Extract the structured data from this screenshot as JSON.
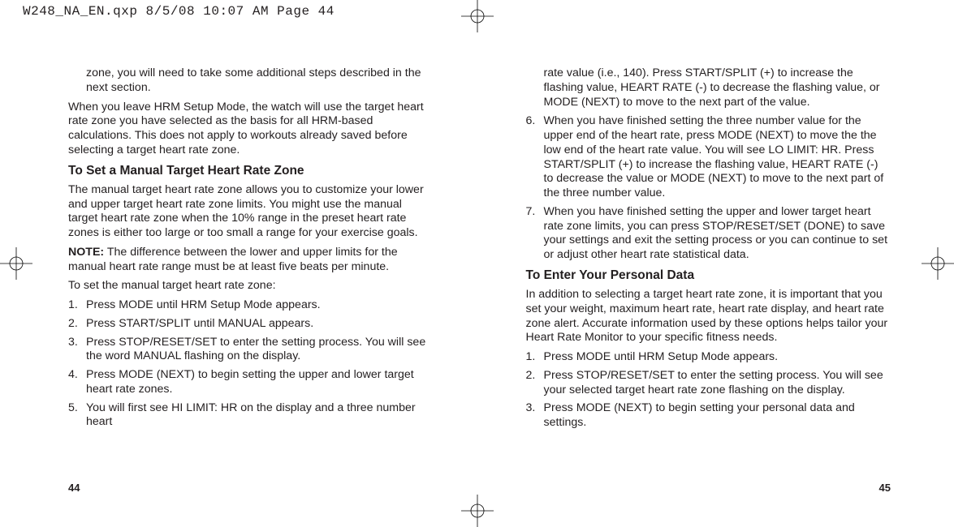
{
  "slug": "W248_NA_EN.qxp  8/5/08  10:07 AM  Page 44",
  "left_page": {
    "cont1": "zone, you will need to take some additional steps described in the next section.",
    "para1": "When you leave HRM Setup Mode, the watch will use the target heart rate zone you have selected as the basis for all HRM-based calculations. This does not apply to workouts already saved before selecting a target heart rate zone.",
    "h1": "To Set a Manual Target Heart Rate Zone",
    "para2": "The manual target heart rate zone allows you to customize your lower and upper target heart rate zone limits. You might use the manual target heart rate zone when the 10% range in the preset heart rate zones is either too large or too small a range for your exercise goals.",
    "note_label": "NOTE:",
    "note_text": " The difference between the lower and upper limits for the manual heart rate range must be at least five beats per minute.",
    "para3": "To set the manual target heart rate zone:",
    "steps": [
      "Press MODE until HRM Setup Mode appears.",
      "Press START/SPLIT until MANUAL appears.",
      "Press STOP/RESET/SET to enter the setting process. You will see the word MANUAL flashing on the display.",
      "Press MODE (NEXT) to begin setting the upper and lower target heart rate zones.",
      "You will first see HI LIMIT: HR on the display and a three number heart"
    ],
    "folio": "44"
  },
  "right_page": {
    "cont1": "rate value (i.e., 140). Press START/SPLIT (+) to increase the flashing value, HEART RATE (-) to decrease the flashing value, or MODE (NEXT) to move to the next part of the value.",
    "step6": "When you have finished setting the three number value for the upper end of the heart rate, press MODE (NEXT) to move the the low end of the heart rate value. You will see LO LIMIT: HR. Press START/SPLIT (+) to increase the flashing value, HEART RATE (-) to decrease the value or MODE (NEXT) to move to the next part of the three number value.",
    "step7": "When you have finished setting the upper and lower target heart rate zone limits, you can press STOP/RESET/SET (DONE) to save your settings and exit the setting process or you can continue to set or adjust other heart rate statistical data.",
    "h1": "To Enter Your Personal Data",
    "para1": "In addition to selecting a target heart rate zone, it is important that you set your weight, maximum heart rate, heart rate display, and heart rate zone alert. Accurate information used by these options helps tailor your Heart Rate Monitor to your specific fitness needs.",
    "steps": [
      "Press MODE until HRM Setup Mode appears.",
      "Press STOP/RESET/SET to enter the setting process. You will see  your selected target heart rate zone flashing on the display.",
      "Press MODE (NEXT) to begin setting your personal data and settings."
    ],
    "folio": "45"
  }
}
